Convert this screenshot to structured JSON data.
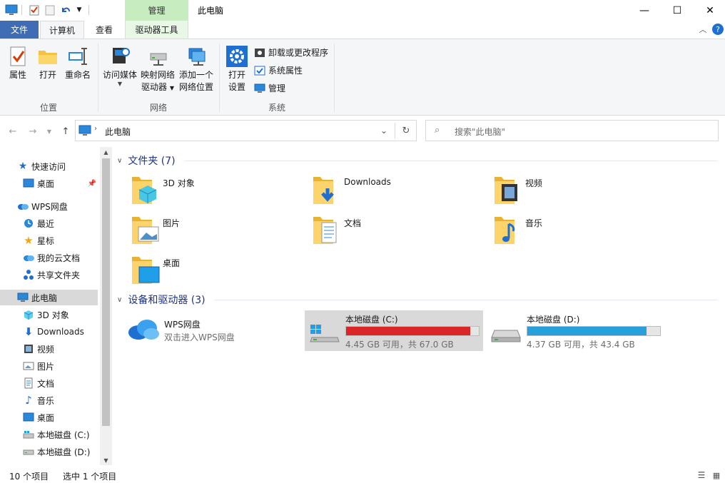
{
  "titlebar": {
    "context_tab": "管理",
    "title": "此电脑",
    "minimize": "—",
    "maximize": "☐",
    "close": "✕"
  },
  "tabs": {
    "file": "文件",
    "computer": "计算机",
    "view": "查看",
    "drive_tools": "驱动器工具"
  },
  "ribbon": {
    "location": {
      "label": "位置",
      "properties": "属性",
      "open": "打开",
      "rename": "重命名"
    },
    "network": {
      "label": "网络",
      "access_media": "访问媒体",
      "map_drive_1": "映射网络",
      "map_drive_2": "驱动器",
      "add_location_1": "添加一个",
      "add_location_2": "网络位置"
    },
    "system": {
      "label": "系统",
      "open_settings_1": "打开",
      "open_settings_2": "设置",
      "uninstall": "卸载或更改程序",
      "system_properties": "系统属性",
      "manage": "管理"
    }
  },
  "address": {
    "path": "此电脑",
    "search_placeholder": "搜索\"此电脑\""
  },
  "nav": {
    "quick_access": "快速访问",
    "desktop_pinned": "桌面",
    "wps": "WPS网盘",
    "recent": "最近",
    "starred": "星标",
    "my_cloud": "我的云文档",
    "shared": "共享文件夹",
    "this_pc": "此电脑",
    "objects3d": "3D 对象",
    "downloads": "Downloads",
    "videos": "视频",
    "pictures": "图片",
    "documents": "文档",
    "music": "音乐",
    "desktop": "桌面",
    "drive_c": "本地磁盘 (C:)",
    "drive_d": "本地磁盘 (D:)"
  },
  "content": {
    "folders_header": "文件夹 (7)",
    "folders": [
      "3D 对象",
      "Downloads",
      "视频",
      "图片",
      "文档",
      "音乐",
      "桌面"
    ],
    "devices_header": "设备和驱动器 (3)",
    "wps_name": "WPS网盘",
    "wps_sub": "双击进入WPS网盘",
    "drive_c": {
      "name": "本地磁盘 (C:)",
      "free": "4.45 GB 可用，共 67.0 GB",
      "used_fraction": 0.934,
      "bar_color": "#da2626"
    },
    "drive_d": {
      "name": "本地磁盘 (D:)",
      "free": "4.37 GB 可用，共 43.4 GB",
      "used_fraction": 0.9,
      "bar_color": "#26a0da"
    }
  },
  "status": {
    "count": "10 个项目",
    "selected": "选中 1 个项目"
  },
  "colors": {
    "accent": "#3e6db5",
    "context_green": "#c6ecc0",
    "header_blue": "#1e3287",
    "selection": "#d9d9d9"
  }
}
